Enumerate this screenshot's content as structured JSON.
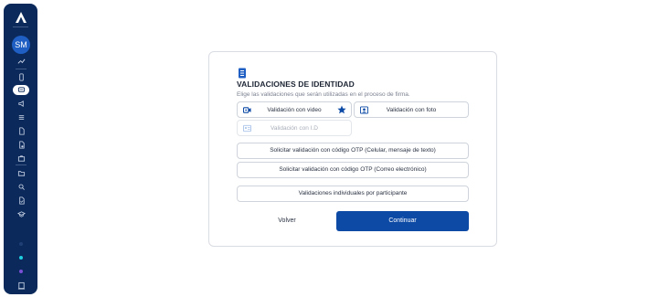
{
  "sidebar": {
    "avatar_initials": "SM",
    "icons": [
      "logo-icon",
      "activity-icon",
      "document-icon",
      "chat-icon",
      "megaphone-icon",
      "list-icon",
      "file-icon",
      "settings-file-icon",
      "briefcase-icon",
      "folder-icon",
      "search-icon",
      "file-check-icon",
      "graduation-icon",
      "exit-icon"
    ],
    "dot_colors": [
      "#1f3f75",
      "#1fd0e0",
      "#7b4fd6"
    ]
  },
  "modal": {
    "title": "VALIDACIONES DE IDENTIDAD",
    "subtitle": "Elige las validaciones que serán utilizadas en el proceso de firma.",
    "options": {
      "video": "Validación con video",
      "photo": "Validación con foto",
      "id": "Validación con I.D"
    },
    "otp_sms": "Solicitar validación con código OTP (Celular, mensaje de texto)",
    "otp_email": "Solicitar validación con código OTP (Correo electrónico)",
    "individual": "Validaciones individuales por participante",
    "back_label": "Volver",
    "continue_label": "Continuar"
  },
  "colors": {
    "sidebar_bg": "#0b2a5b",
    "accent": "#0d4aa6"
  }
}
